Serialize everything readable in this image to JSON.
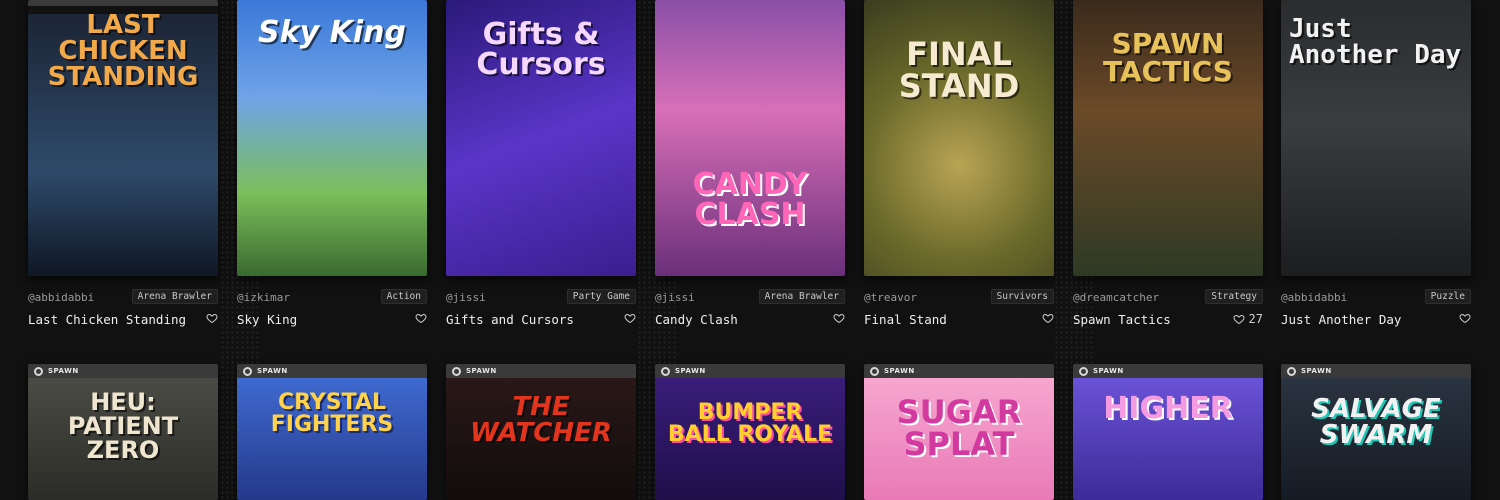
{
  "badge": "SPAWN",
  "row1": [
    {
      "cover_title": "LAST CHICKEN STANDING",
      "creator": "@abbidabbi",
      "genre": "Arena Brawler",
      "name": "Last Chicken Standing",
      "likes": "",
      "bg": "#243447",
      "accent": "#e8a23a"
    },
    {
      "cover_title": "Sky King",
      "creator": "@izkimar",
      "genre": "Action",
      "name": "Sky King",
      "likes": "",
      "bg": "#3f7ad8",
      "accent": "#ffffff"
    },
    {
      "cover_title": "Gifts & Cursors",
      "creator": "@jissi",
      "genre": "Party Game",
      "name": "Gifts and Cursors",
      "likes": "",
      "bg": "#3b2a8f",
      "accent": "#f5d6ff"
    },
    {
      "cover_title": "CANDY CLASH",
      "creator": "@jissi",
      "genre": "Arena Brawler",
      "name": "Candy Clash",
      "likes": "",
      "bg": "#c24fa0",
      "accent": "#ff5fb0"
    },
    {
      "cover_title": "FINAL STAND",
      "creator": "@treavor",
      "genre": "Survivors",
      "name": "Final Stand",
      "likes": "",
      "bg": "#5f6a2c",
      "accent": "#f6ead0"
    },
    {
      "cover_title": "SPAWN TACTICS",
      "creator": "@dreamcatcher",
      "genre": "Strategy",
      "name": "Spawn Tactics",
      "likes": "27",
      "bg": "#4a3220",
      "accent": "#e7c15a"
    },
    {
      "cover_title": "Just Another Day",
      "creator": "@abbidabbi",
      "genre": "Puzzle",
      "name": "Just Another Day",
      "likes": "",
      "bg": "#2f3234",
      "accent": "#f2f2f2"
    }
  ],
  "row2": [
    {
      "cover_title": "HEU: PATIENT ZERO",
      "bg": "#3a3b35",
      "accent": "#f0e6cf"
    },
    {
      "cover_title": "CRYSTAL FIGHTERS",
      "bg": "#2f4fa6",
      "accent": "#ffd24a"
    },
    {
      "cover_title": "THE WATCHER",
      "bg": "#1d1414",
      "accent": "#e3341e"
    },
    {
      "cover_title": "BUMPER BALL ROYALE",
      "bg": "#3a1d7a",
      "accent": "#ffcf2e"
    },
    {
      "cover_title": "SUGAR SPLAT",
      "bg": "#f08ec0",
      "accent": "#d23aa0"
    },
    {
      "cover_title": "HIGHER",
      "bg": "#5b45c8",
      "accent": "#f49ae0"
    },
    {
      "cover_title": "SALVAGE SWARM",
      "bg": "#2a3340",
      "accent": "#f1f1f1"
    }
  ]
}
